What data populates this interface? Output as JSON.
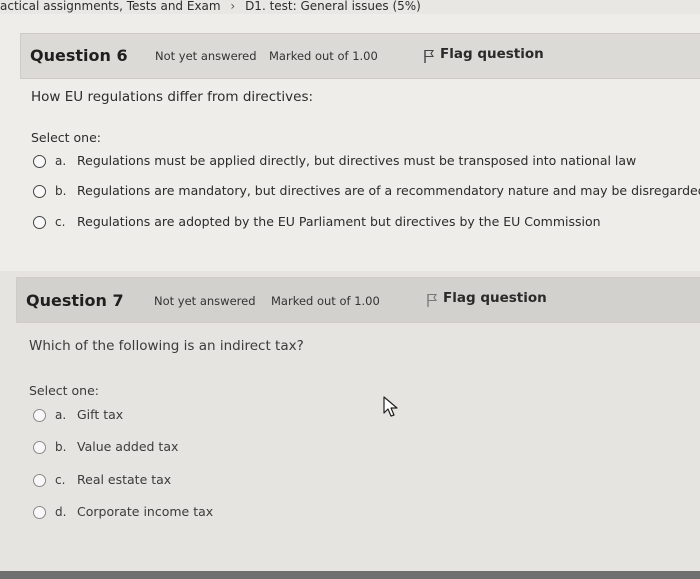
{
  "breadcrumb": {
    "course": "actical assignments, Tests and Exam",
    "separator": "›",
    "page": "D1. test: General issues (5%)"
  },
  "questions": [
    {
      "number_label": "Question 6",
      "status": "Not yet answered",
      "marks": "Marked out of 1.00",
      "flag_label": "Flag question",
      "text": "How EU regulations differ from directives:",
      "select_label": "Select one:",
      "options": [
        {
          "letter": "a.",
          "text": "Regulations must be applied directly, but directives must be transposed into national law"
        },
        {
          "letter": "b.",
          "text": "Regulations are mandatory, but directives are of a recommendatory nature and may be disregarded"
        },
        {
          "letter": "c.",
          "text": "Regulations are adopted by the EU Parliament but directives by the EU Commission"
        }
      ]
    },
    {
      "number_label": "Question 7",
      "status": "Not yet answered",
      "marks": "Marked out of 1.00",
      "flag_label": "Flag question",
      "text": "Which of the following is an indirect tax?",
      "select_label": "Select one:",
      "options": [
        {
          "letter": "a.",
          "text": "Gift tax"
        },
        {
          "letter": "b.",
          "text": "Value added tax"
        },
        {
          "letter": "c.",
          "text": "Real estate tax"
        },
        {
          "letter": "d.",
          "text": "Corporate income tax"
        }
      ]
    }
  ],
  "icons": {
    "flag": "flag-icon",
    "cursor": "mouse-pointer-icon"
  }
}
